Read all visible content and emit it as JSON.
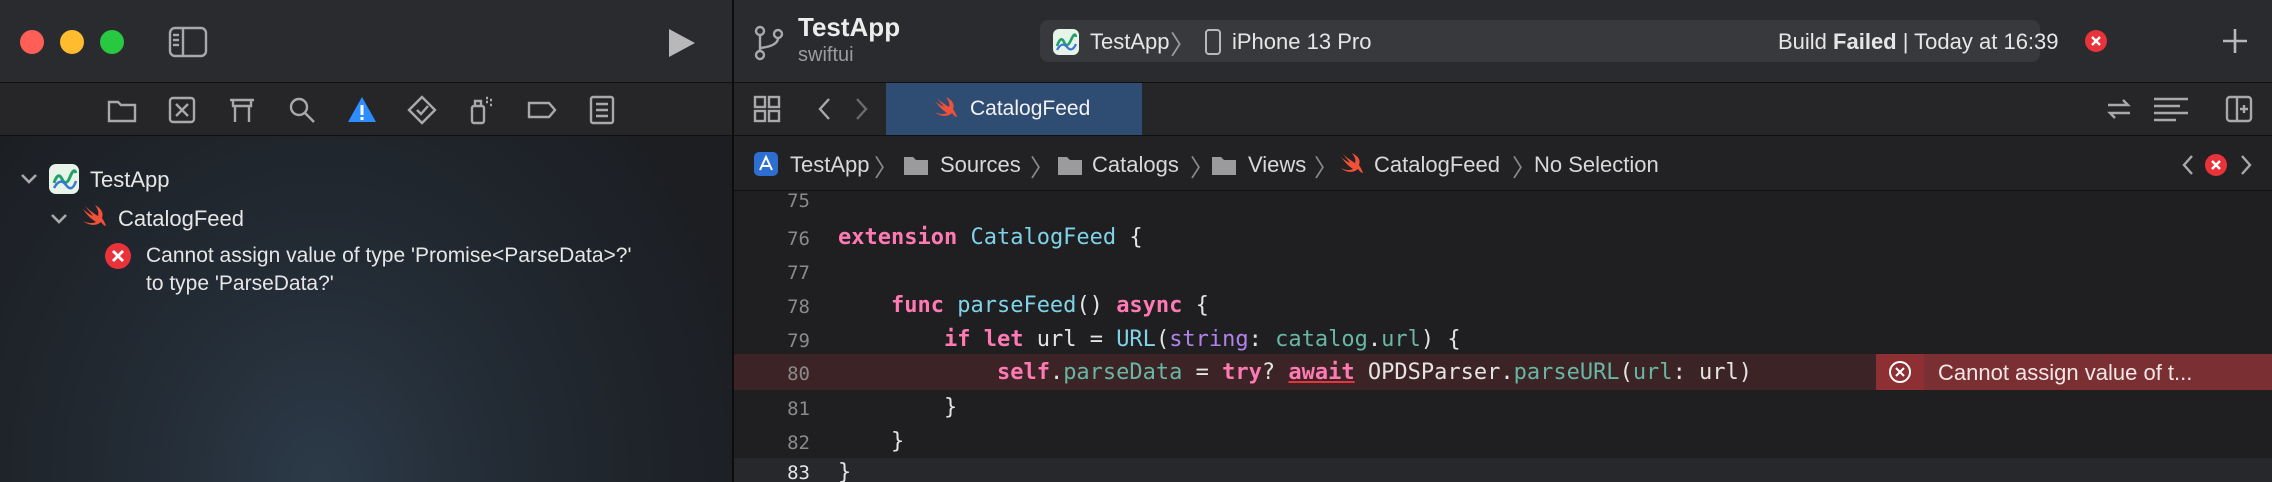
{
  "colors": {
    "accent": "#0a84ff",
    "error": "#e9333b",
    "swift": "#f05138",
    "close": "#ff5f57",
    "minimize": "#febc2e",
    "zoom": "#28c840"
  },
  "window": {
    "project": "TestApp",
    "branch": "swiftui"
  },
  "sidebar": {
    "tree": {
      "project": "TestApp",
      "file": "CatalogFeed",
      "issue_line1": "Cannot assign value of type 'Promise<ParseData>?'",
      "issue_line2": "to type 'ParseData?'"
    }
  },
  "toolbar": {
    "scheme": "TestApp",
    "device": "iPhone 13 Pro",
    "build_label": "Build",
    "build_status": "Failed",
    "build_time": "| Today at 16:39"
  },
  "tab": {
    "label": "CatalogFeed"
  },
  "jumpbar": {
    "items": [
      "TestApp",
      "Sources",
      "Catalogs",
      "Views",
      "CatalogFeed",
      "No Selection"
    ]
  },
  "code": {
    "line_numbers": [
      "75",
      "76",
      "77",
      "78",
      "79",
      "80",
      "81",
      "82",
      "83"
    ],
    "error_message": "Cannot assign value of t..."
  }
}
